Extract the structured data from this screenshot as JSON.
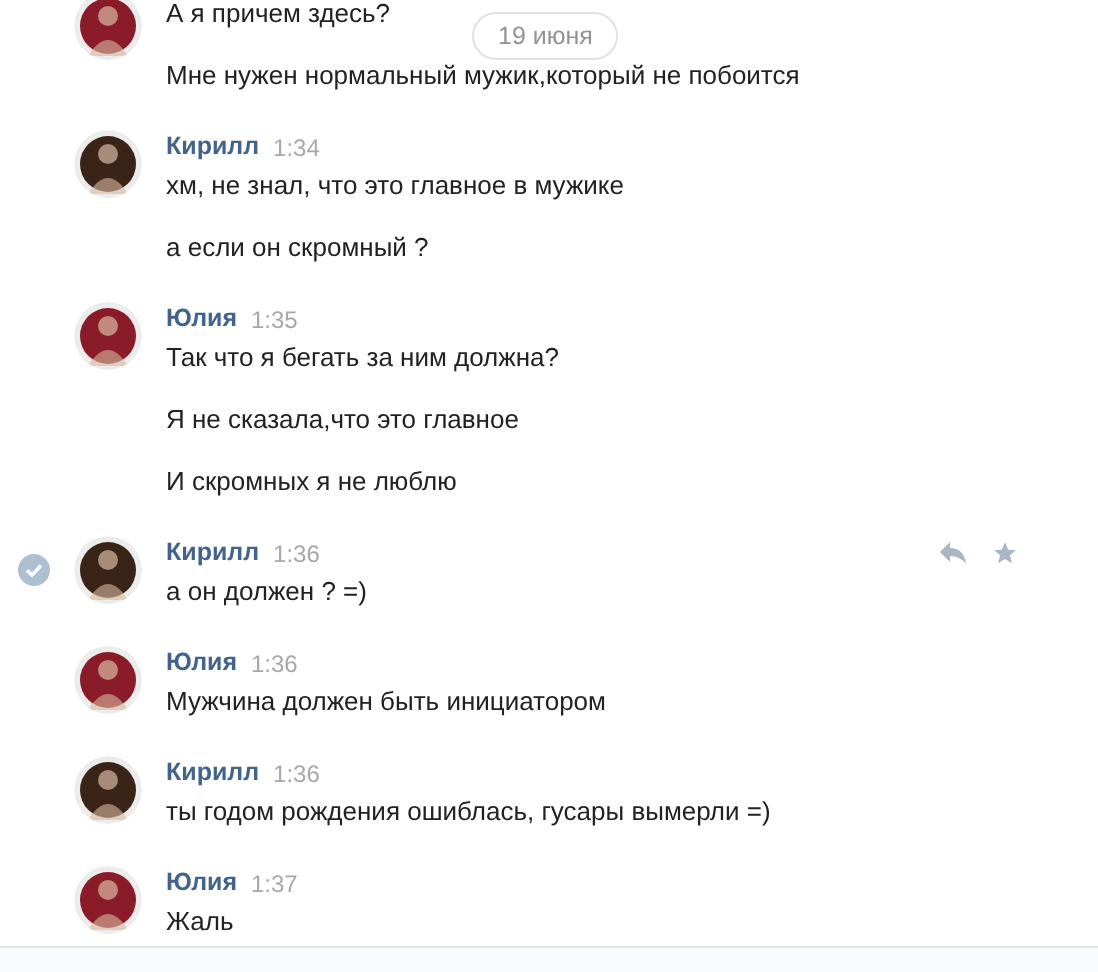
{
  "date_divider": "19 июня",
  "messages": [
    {
      "color": "#8a1c2a",
      "selected": false,
      "lines": [
        "А я причем здесь?",
        "Мне нужен нормальный мужик,который не побоится"
      ]
    },
    {
      "author": "Кирилл",
      "time": "1:34",
      "color": "#3a2418",
      "selected": false,
      "lines": [
        "хм, не знал, что это главное в мужике",
        "а если он скромный ?"
      ]
    },
    {
      "author": "Юлия",
      "time": "1:35",
      "color": "#8a1c2a",
      "selected": false,
      "lines": [
        "Так что я бегать за ним должна?",
        "Я не сказала,что это главное",
        "И скромных я не люблю"
      ]
    },
    {
      "author": "Кирилл",
      "time": "1:36",
      "color": "#3a2418",
      "selected": true,
      "lines": [
        "а он должен ? =)"
      ]
    },
    {
      "author": "Юлия",
      "time": "1:36",
      "color": "#8a1c2a",
      "selected": false,
      "lines": [
        "Мужчина должен быть инициатором"
      ]
    },
    {
      "author": "Кирилл",
      "time": "1:36",
      "color": "#3a2418",
      "selected": false,
      "lines": [
        "ты годом рождения ошиблась, гусары вымерли =)"
      ]
    },
    {
      "author": "Юлия",
      "time": "1:37",
      "color": "#8a1c2a",
      "selected": false,
      "lines": [
        "Жаль"
      ]
    }
  ]
}
